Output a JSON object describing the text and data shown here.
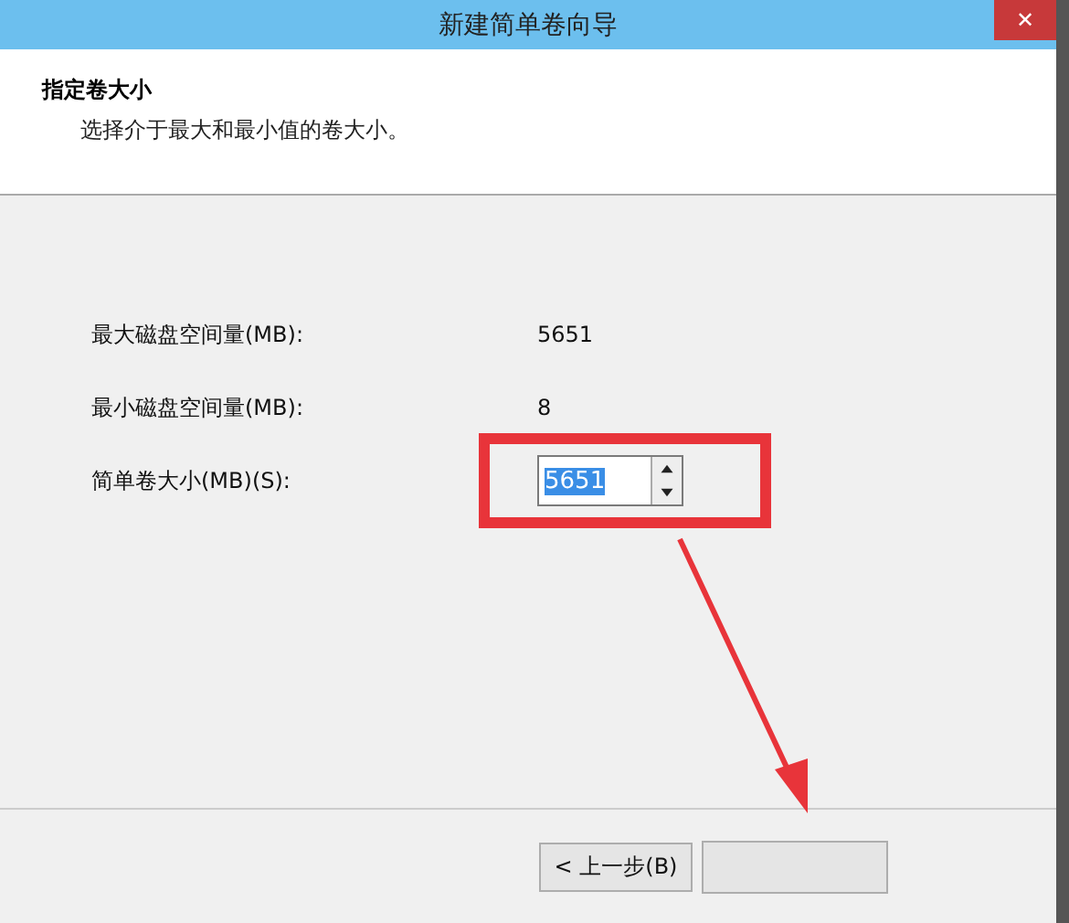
{
  "window": {
    "title": "新建简单卷向导",
    "close": "✕"
  },
  "header": {
    "title": "指定卷大小",
    "subtitle": "选择介于最大和最小值的卷大小。"
  },
  "fields": [
    {
      "kind": "readout",
      "label": "最大磁盘空间量(MB):",
      "value": "5651"
    },
    {
      "kind": "readout",
      "label": "最小磁盘空间量(MB):",
      "value": "8"
    },
    {
      "kind": "spinner",
      "label": "简单卷大小(MB)(S):",
      "value": "5651",
      "selected": true
    }
  ],
  "buttons": [
    {
      "label": "< 上一步(B)"
    }
  ]
}
